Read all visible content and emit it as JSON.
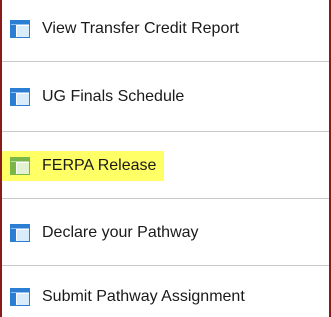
{
  "menu": {
    "items": [
      {
        "label": "View Transfer Credit Report",
        "icon": "window-icon",
        "highlighted": false
      },
      {
        "label": "UG Finals Schedule",
        "icon": "window-icon",
        "highlighted": false
      },
      {
        "label": "FERPA Release",
        "icon": "window-icon",
        "highlighted": true
      },
      {
        "label": "Declare your Pathway",
        "icon": "window-icon",
        "highlighted": false
      },
      {
        "label": "Submit Pathway Assignment",
        "icon": "window-icon",
        "highlighted": false
      }
    ]
  },
  "colors": {
    "border": "#8b1a1a",
    "highlight": "#ffff66",
    "icon_blue": "#2a7fd4",
    "icon_green": "#7ab648"
  }
}
